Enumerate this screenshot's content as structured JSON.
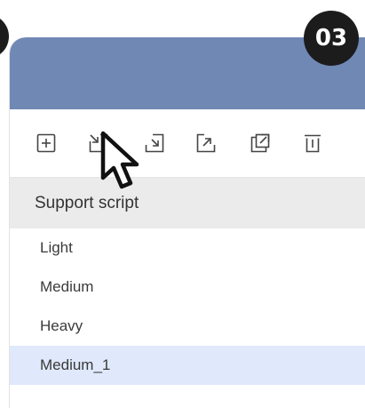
{
  "step_badge": "03",
  "toolbar": {
    "buttons": [
      {
        "icon": "add-icon"
      },
      {
        "icon": "collapse-icon"
      },
      {
        "icon": "expand-icon"
      },
      {
        "icon": "export-icon"
      },
      {
        "icon": "duplicate-icon"
      },
      {
        "icon": "delete-icon"
      }
    ]
  },
  "section": {
    "title": "Support script"
  },
  "list": {
    "items": [
      {
        "label": "Light"
      },
      {
        "label": "Medium"
      },
      {
        "label": "Heavy"
      },
      {
        "label": "Medium_1",
        "selected": true
      }
    ]
  },
  "colors": {
    "header": "#7088b4",
    "section_bg": "#ebebeb",
    "selected_bg": "#dfe9fb",
    "badge_bg": "#1c1c1c"
  }
}
